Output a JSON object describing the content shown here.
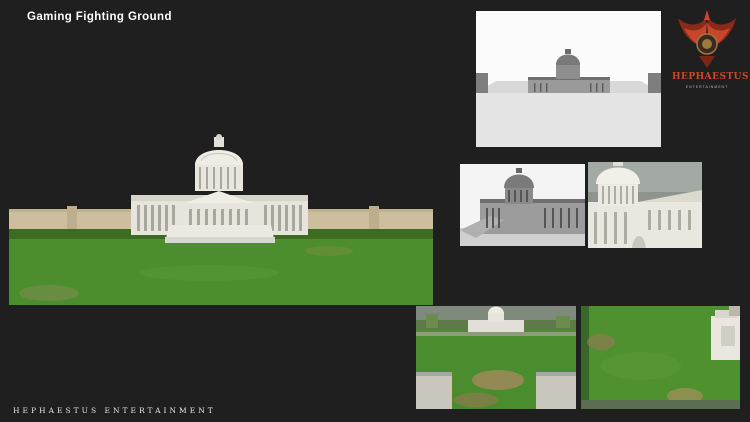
{
  "header": {
    "title": "Gaming Fighting Ground"
  },
  "footer": {
    "company": "HEPHAESTUS ENTERTAINMENT"
  },
  "logo": {
    "wordmark": "HEPHAESTUS",
    "tagline": "ENTERTAINMENT"
  },
  "colors": {
    "background": "#1f1f1f",
    "grass": "#4c8e2e",
    "building": "#e6e4dc",
    "wall": "#cdbf9e",
    "logo_accent": "#d2462a"
  },
  "panels": [
    {
      "id": "main-view",
      "content": "capitol-front-wide"
    },
    {
      "id": "render-white",
      "content": "capitol-clay-render"
    },
    {
      "id": "render-angle",
      "content": "capitol-side-angle"
    },
    {
      "id": "closeup-dome",
      "content": "capitol-dome-closeup"
    },
    {
      "id": "ground-view",
      "content": "arena-ground-level"
    },
    {
      "id": "top-view",
      "content": "arena-top-down"
    }
  ]
}
